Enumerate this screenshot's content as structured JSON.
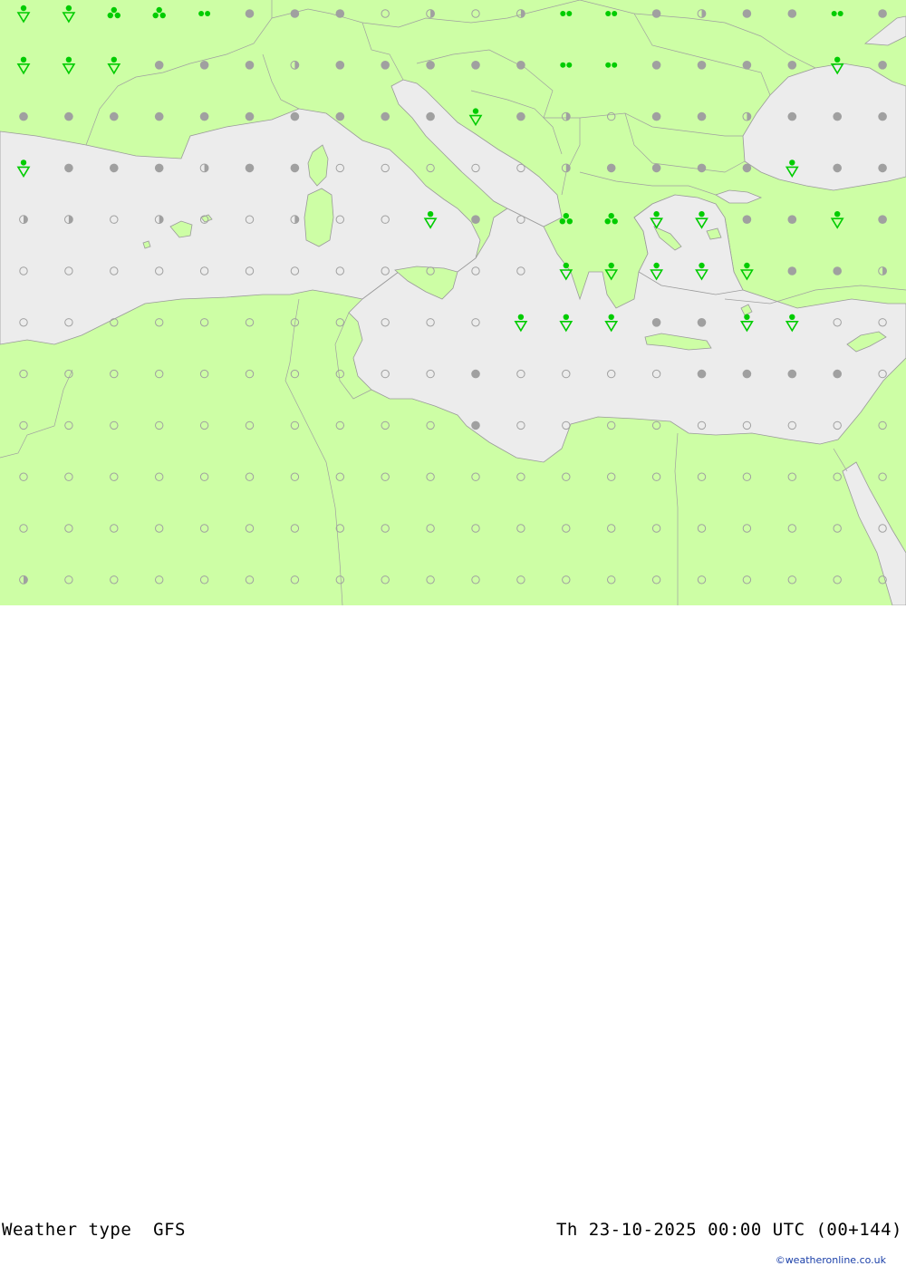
{
  "map": {
    "colors": {
      "land": "#cdfea5",
      "sea": "#ececec",
      "coast": "#9a9a9a",
      "symbol_cloud": "#a0a0a0",
      "symbol_precip": "#00cc00"
    },
    "grid_symbols": [
      [
        "showers",
        "showers",
        "rain",
        "rain",
        "drizzle",
        "overcast",
        "overcast",
        "overcast",
        "clear",
        "partly",
        "clear",
        "partly",
        "drizzle",
        "drizzle",
        "overcast",
        "partly",
        "overcast",
        "overcast",
        "drizzle",
        "overcast"
      ],
      [
        "showers",
        "showers",
        "showers",
        "overcast",
        "overcast",
        "overcast",
        "partly",
        "overcast",
        "overcast",
        "overcast",
        "overcast",
        "overcast",
        "drizzle",
        "drizzle",
        "overcast",
        "overcast",
        "overcast",
        "overcast",
        "showers",
        "overcast"
      ],
      [
        "overcast",
        "overcast",
        "overcast",
        "overcast",
        "overcast",
        "overcast",
        "overcast",
        "overcast",
        "overcast",
        "overcast",
        "showers",
        "overcast",
        "partly",
        "clear",
        "overcast",
        "overcast",
        "partly",
        "overcast",
        "overcast",
        "overcast"
      ],
      [
        "showers",
        "overcast",
        "overcast",
        "overcast",
        "partly",
        "overcast",
        "overcast",
        "clear",
        "clear",
        "clear",
        "clear",
        "clear",
        "partly",
        "overcast",
        "overcast",
        "overcast",
        "overcast",
        "showers",
        "overcast",
        "overcast"
      ],
      [
        "partly",
        "partly",
        "clear",
        "partly",
        "clear",
        "clear",
        "partly",
        "clear",
        "clear",
        "showers",
        "overcast",
        "clear",
        "rain",
        "rain",
        "showers",
        "showers",
        "overcast",
        "overcast",
        "showers",
        "overcast"
      ],
      [
        "clear",
        "clear",
        "clear",
        "clear",
        "clear",
        "clear",
        "clear",
        "clear",
        "clear",
        "clear",
        "clear",
        "clear",
        "showers",
        "showers",
        "showers",
        "showers",
        "showers",
        "overcast",
        "overcast",
        "partly"
      ],
      [
        "clear",
        "clear",
        "clear",
        "clear",
        "clear",
        "clear",
        "clear",
        "clear",
        "clear",
        "clear",
        "clear",
        "showers",
        "showers",
        "showers",
        "overcast",
        "overcast",
        "showers",
        "showers",
        "clear",
        "clear"
      ],
      [
        "clear",
        "clear",
        "clear",
        "clear",
        "clear",
        "clear",
        "clear",
        "clear",
        "clear",
        "clear",
        "overcast",
        "clear",
        "clear",
        "clear",
        "clear",
        "overcast",
        "overcast",
        "overcast",
        "overcast",
        "clear"
      ],
      [
        "clear",
        "clear",
        "clear",
        "clear",
        "clear",
        "clear",
        "clear",
        "clear",
        "clear",
        "clear",
        "overcast",
        "clear",
        "clear",
        "clear",
        "clear",
        "clear",
        "clear",
        "clear",
        "clear",
        "clear"
      ],
      [
        "clear",
        "clear",
        "clear",
        "clear",
        "clear",
        "clear",
        "clear",
        "clear",
        "clear",
        "clear",
        "clear",
        "clear",
        "clear",
        "clear",
        "clear",
        "clear",
        "clear",
        "clear",
        "clear",
        "clear"
      ],
      [
        "clear",
        "clear",
        "clear",
        "clear",
        "clear",
        "clear",
        "clear",
        "clear",
        "clear",
        "clear",
        "clear",
        "clear",
        "clear",
        "clear",
        "clear",
        "clear",
        "clear",
        "clear",
        "clear",
        "clear"
      ],
      [
        "partly",
        "clear",
        "clear",
        "clear",
        "clear",
        "clear",
        "clear",
        "clear",
        "clear",
        "clear",
        "clear",
        "clear",
        "clear",
        "clear",
        "clear",
        "clear",
        "clear",
        "clear",
        "clear",
        "clear"
      ]
    ]
  },
  "footer": {
    "title": "Weather type  GFS",
    "datetime": "Th 23-10-2025 00:00 UTC (00+144)",
    "credit": "©weatheronline.co.uk"
  }
}
